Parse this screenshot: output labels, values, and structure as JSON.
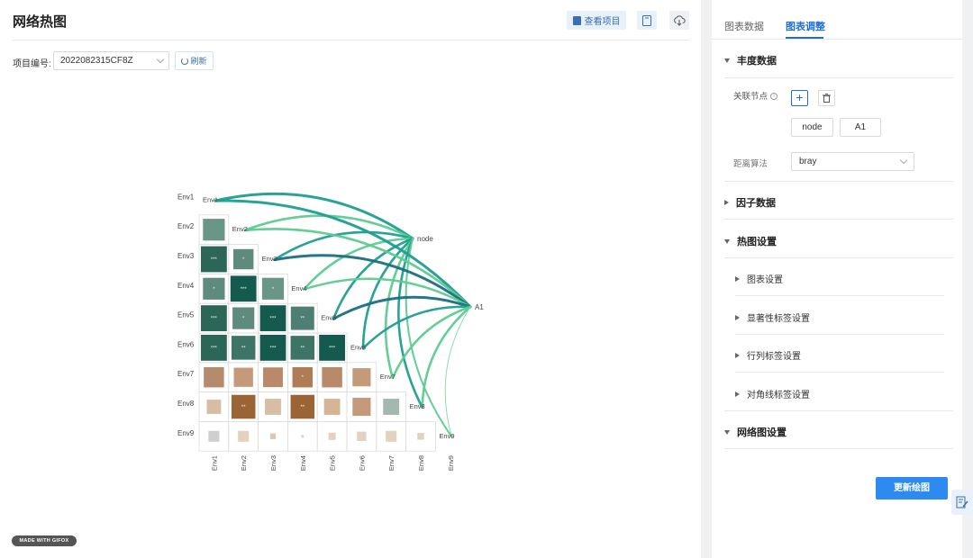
{
  "header": {
    "title": "网络热图",
    "view_project_label": "查看项目",
    "doc_icon": "document-icon",
    "download_icon": "cloud-download-icon"
  },
  "toolbar": {
    "project_label": "项目编号:",
    "project_value": "2022082315CF8Z",
    "refresh_label": "刷新"
  },
  "watermark": "MADE WITH GIFOX",
  "chart_data": {
    "type": "heatmap",
    "rows": [
      "Env1",
      "Env2",
      "Env3",
      "Env4",
      "Env5",
      "Env6",
      "Env7",
      "Env8",
      "Env9"
    ],
    "cols": [
      "Env1",
      "Env2",
      "Env3",
      "Env4",
      "Env5",
      "Env6",
      "Env7",
      "Env8",
      "Env9"
    ],
    "diag_labels": [
      "Env1",
      "Env2",
      "Env3",
      "Env4",
      "Env5",
      "Env6",
      "Env7",
      "Env8",
      "Env9"
    ],
    "cells": [
      {
        "r": 1,
        "c": 0,
        "color": "#6a9688",
        "size": 0.84,
        "sig": ""
      },
      {
        "r": 2,
        "c": 0,
        "color": "#2c6657",
        "size": 1.0,
        "sig": "***"
      },
      {
        "r": 2,
        "c": 1,
        "color": "#5e8b7e",
        "size": 0.78,
        "sig": "*"
      },
      {
        "r": 3,
        "c": 0,
        "color": "#5e8b7e",
        "size": 0.84,
        "sig": "*"
      },
      {
        "r": 3,
        "c": 1,
        "color": "#155a4e",
        "size": 1.0,
        "sig": "***"
      },
      {
        "r": 3,
        "c": 2,
        "color": "#6a9688",
        "size": 0.84,
        "sig": "*"
      },
      {
        "r": 4,
        "c": 0,
        "color": "#2c6657",
        "size": 1.0,
        "sig": "***"
      },
      {
        "r": 4,
        "c": 1,
        "color": "#5e8b7e",
        "size": 0.84,
        "sig": "*"
      },
      {
        "r": 4,
        "c": 2,
        "color": "#155a4e",
        "size": 1.0,
        "sig": "***"
      },
      {
        "r": 4,
        "c": 3,
        "color": "#4f7f73",
        "size": 0.9,
        "sig": "**"
      },
      {
        "r": 5,
        "c": 0,
        "color": "#2c6657",
        "size": 1.0,
        "sig": "***"
      },
      {
        "r": 5,
        "c": 1,
        "color": "#3c7466",
        "size": 0.92,
        "sig": "**"
      },
      {
        "r": 5,
        "c": 2,
        "color": "#155a4e",
        "size": 1.0,
        "sig": "***"
      },
      {
        "r": 5,
        "c": 3,
        "color": "#3c7466",
        "size": 0.92,
        "sig": "**"
      },
      {
        "r": 5,
        "c": 4,
        "color": "#155a4e",
        "size": 1.0,
        "sig": "***"
      },
      {
        "r": 6,
        "c": 0,
        "color": "#b48c6c",
        "size": 0.78,
        "sig": ""
      },
      {
        "r": 6,
        "c": 1,
        "color": "#c49a7a",
        "size": 0.74,
        "sig": ""
      },
      {
        "r": 6,
        "c": 2,
        "color": "#b88a6a",
        "size": 0.76,
        "sig": ""
      },
      {
        "r": 6,
        "c": 3,
        "color": "#b07c55",
        "size": 0.78,
        "sig": "*"
      },
      {
        "r": 6,
        "c": 4,
        "color": "#b88a6a",
        "size": 0.78,
        "sig": ""
      },
      {
        "r": 6,
        "c": 5,
        "color": "#c49a7a",
        "size": 0.7,
        "sig": ""
      },
      {
        "r": 7,
        "c": 0,
        "color": "#d6bda4",
        "size": 0.55,
        "sig": ""
      },
      {
        "r": 7,
        "c": 1,
        "color": "#9a6434",
        "size": 0.92,
        "sig": "**"
      },
      {
        "r": 7,
        "c": 2,
        "color": "#d6bda4",
        "size": 0.62,
        "sig": ""
      },
      {
        "r": 7,
        "c": 3,
        "color": "#9a6434",
        "size": 0.92,
        "sig": "**"
      },
      {
        "r": 7,
        "c": 4,
        "color": "#d4b596",
        "size": 0.62,
        "sig": ""
      },
      {
        "r": 7,
        "c": 5,
        "color": "#c49a7a",
        "size": 0.7,
        "sig": ""
      },
      {
        "r": 7,
        "c": 6,
        "color": "#a3b8ae",
        "size": 0.62,
        "sig": ""
      },
      {
        "r": 8,
        "c": 0,
        "color": "#cfcfcf",
        "size": 0.42,
        "sig": ""
      },
      {
        "r": 8,
        "c": 1,
        "color": "#e3d2bf",
        "size": 0.42,
        "sig": ""
      },
      {
        "r": 8,
        "c": 2,
        "color": "#dcc8b2",
        "size": 0.22,
        "sig": ""
      },
      {
        "r": 8,
        "c": 3,
        "color": "#e0d2c4",
        "size": 0.1,
        "sig": ""
      },
      {
        "r": 8,
        "c": 4,
        "color": "#e3d2bf",
        "size": 0.28,
        "sig": ""
      },
      {
        "r": 8,
        "c": 5,
        "color": "#e3d2bf",
        "size": 0.36,
        "sig": ""
      },
      {
        "r": 8,
        "c": 6,
        "color": "#e3d2bf",
        "size": 0.42,
        "sig": ""
      },
      {
        "r": 8,
        "c": 7,
        "color": "#e3d2bf",
        "size": 0.26,
        "sig": ""
      }
    ],
    "nodes": [
      "node",
      "A1"
    ],
    "links": [
      {
        "from": "node",
        "to": "Env1",
        "color": "#1e9e8f",
        "width": 3.0
      },
      {
        "from": "node",
        "to": "Env2",
        "color": "#5ccb8f",
        "width": 2.6
      },
      {
        "from": "node",
        "to": "Env3",
        "color": "#1e9e8f",
        "width": 2.6
      },
      {
        "from": "node",
        "to": "Env4",
        "color": "#5ccb8f",
        "width": 2.6
      },
      {
        "from": "node",
        "to": "Env5",
        "color": "#1e9e8f",
        "width": 2.6
      },
      {
        "from": "node",
        "to": "Env6",
        "color": "#1e9e8f",
        "width": 2.6
      },
      {
        "from": "node",
        "to": "Env7",
        "color": "#5ccb8f",
        "width": 2.6
      },
      {
        "from": "node",
        "to": "Env8",
        "color": "#1e9e8f",
        "width": 2.6
      },
      {
        "from": "node",
        "to": "Env9",
        "color": "#5ccb8f",
        "width": 2.0
      },
      {
        "from": "A1",
        "to": "Env1",
        "color": "#1e9e8f",
        "width": 3.0
      },
      {
        "from": "A1",
        "to": "Env2",
        "color": "#5ccb8f",
        "width": 2.6
      },
      {
        "from": "A1",
        "to": "Env3",
        "color": "#1b6f82",
        "width": 3.0
      },
      {
        "from": "A1",
        "to": "Env4",
        "color": "#5ccb8f",
        "width": 2.4
      },
      {
        "from": "A1",
        "to": "Env5",
        "color": "#1b6f82",
        "width": 3.0
      },
      {
        "from": "A1",
        "to": "Env6",
        "color": "#1e9e8f",
        "width": 2.6
      },
      {
        "from": "A1",
        "to": "Env7",
        "color": "#5ccb8f",
        "width": 2.6
      },
      {
        "from": "A1",
        "to": "Env8",
        "color": "#5ccb8f",
        "width": 2.6
      },
      {
        "from": "A1",
        "to": "Env9",
        "color": "#8ad9a8",
        "width": 1.0
      }
    ]
  },
  "sidebar": {
    "tabs": [
      {
        "label": "图表数据",
        "active": false
      },
      {
        "label": "图表调整",
        "active": true
      }
    ],
    "abundance": {
      "title": "丰度数据",
      "node_label": "关联节点",
      "chips": [
        "node",
        "A1"
      ],
      "distance_label": "距离算法",
      "distance_value": "bray"
    },
    "factor_title": "因子数据",
    "heatmap": {
      "title": "热图设置",
      "sub_items": [
        "图表设置",
        "显著性标签设置",
        "行列标签设置",
        "对角线标签设置"
      ]
    },
    "network_title": "网络图设置",
    "update_button": "更新绘图"
  },
  "accent_color": "#1e6fd0"
}
